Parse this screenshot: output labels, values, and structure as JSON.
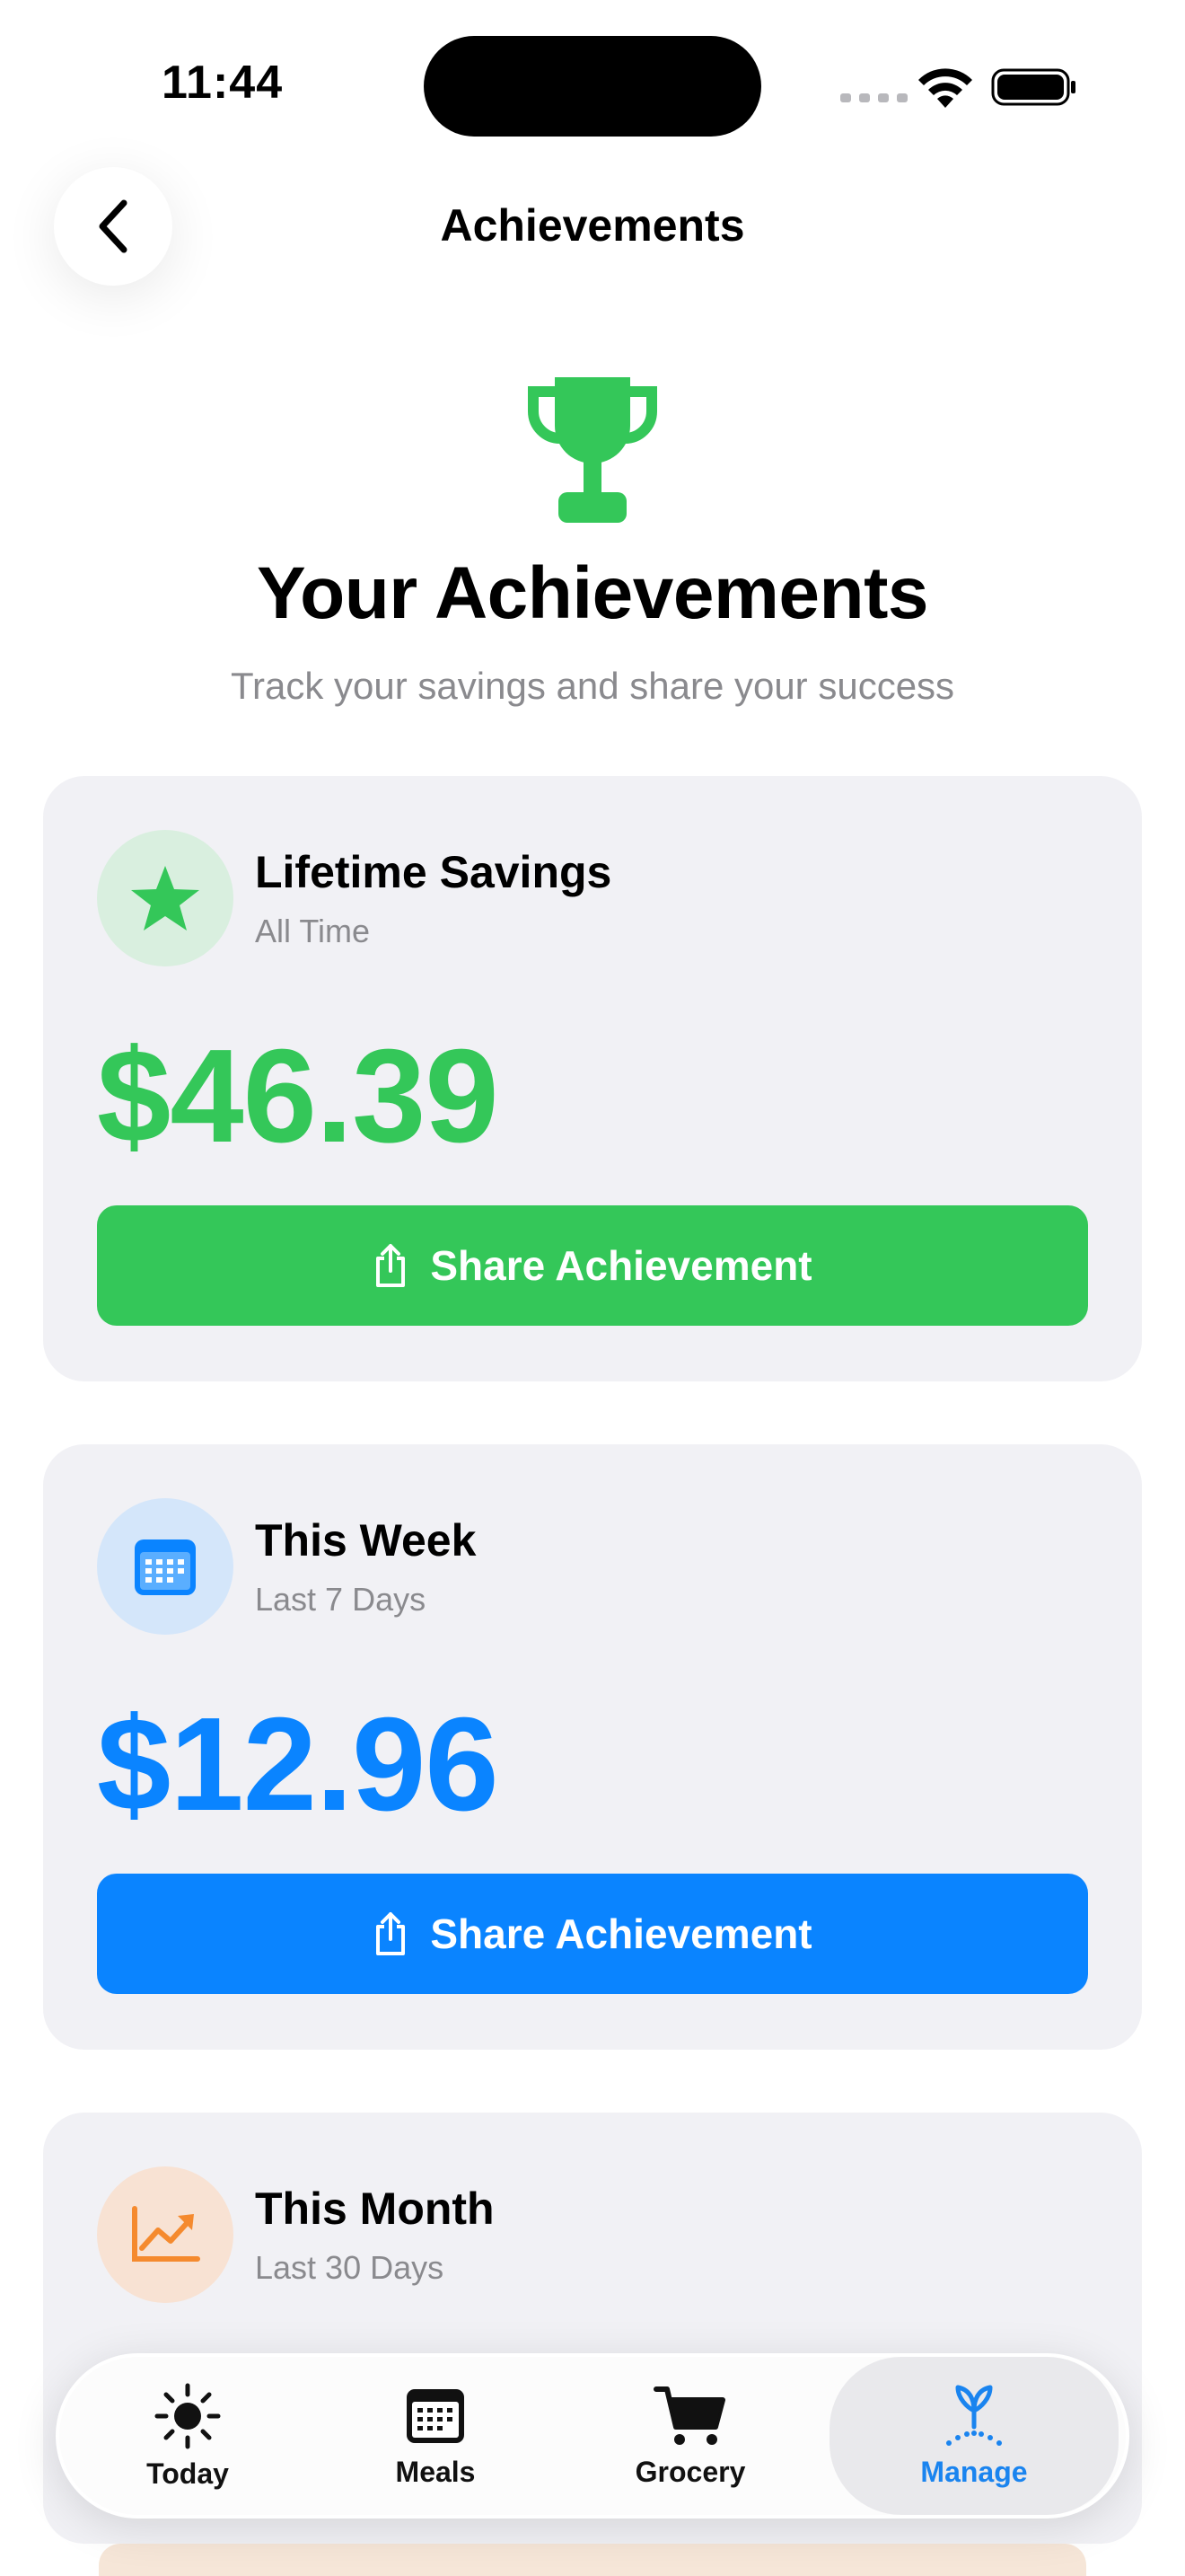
{
  "status_bar": {
    "time": "11:44"
  },
  "header": {
    "title": "Achievements"
  },
  "hero": {
    "title": "Your Achievements",
    "subtitle": "Track your savings and share your success"
  },
  "cards": [
    {
      "title": "Lifetime Savings",
      "subtitle": "All Time",
      "amount": "$46.39",
      "button_label": "Share Achievement",
      "accent": "#34c759",
      "icon": "star-icon"
    },
    {
      "title": "This Week",
      "subtitle": "Last 7 Days",
      "amount": "$12.96",
      "button_label": "Share Achievement",
      "accent": "#0a84ff",
      "icon": "calendar-icon"
    },
    {
      "title": "This Month",
      "subtitle": "Last 30 Days",
      "accent": "#f58a2e",
      "icon": "chart-trend-icon"
    }
  ],
  "tabs": [
    {
      "label": "Today",
      "icon": "sun-icon"
    },
    {
      "label": "Meals",
      "icon": "calendar-icon"
    },
    {
      "label": "Grocery",
      "icon": "cart-icon"
    },
    {
      "label": "Manage",
      "icon": "sprout-icon",
      "selected": true
    }
  ],
  "colors": {
    "green": "#34c759",
    "blue": "#0a84ff",
    "orange": "#f58a2e",
    "active_tab": "#1a84ef"
  }
}
